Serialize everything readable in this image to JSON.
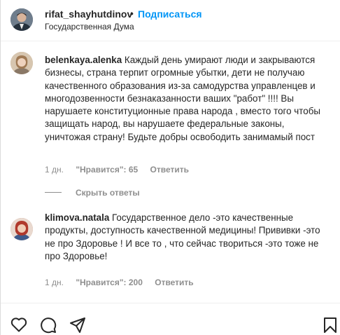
{
  "header": {
    "username": "rifat_shayhutdinov",
    "separator": "•",
    "follow_label": "Подписаться",
    "subtitle": "Государственная Дума"
  },
  "comments": [
    {
      "username": "belenkaya.alenka",
      "text": "Каждый день умирают люди и закрываются бизнесы, страна терпит огромные убытки, дети не получаю качественного образования из-за самодурства управленцев и многодозвенности безнаказанности ваших \"работ\" !!!! Вы нарушаете конституционные права народа , вместо того чтобы защищать народ, вы нарушаете федеральные законы, уничтожая страну! Будьте добры освободить занимамый пост",
      "time": "1 дн.",
      "likes": "\"Нравится\": 65",
      "reply_label": "Ответить"
    },
    {
      "username": "klimova.natala",
      "text": "Государственное дело -это качественные продукты, доступность качественной медицины! Прививки -это не про Здоровье ! И все то , что сейчас твориться -это тоже не про Здоровье!",
      "time": "1 дн.",
      "likes": "\"Нравится\": 200",
      "reply_label": "Ответить"
    }
  ],
  "hide_replies_label": "Скрыть ответы",
  "colors": {
    "accent": "#0095f6",
    "text": "#262626",
    "secondary": "#8e8e8e",
    "border": "#efefef"
  },
  "icons": [
    "heart-icon",
    "comment-icon",
    "share-icon",
    "bookmark-icon"
  ]
}
